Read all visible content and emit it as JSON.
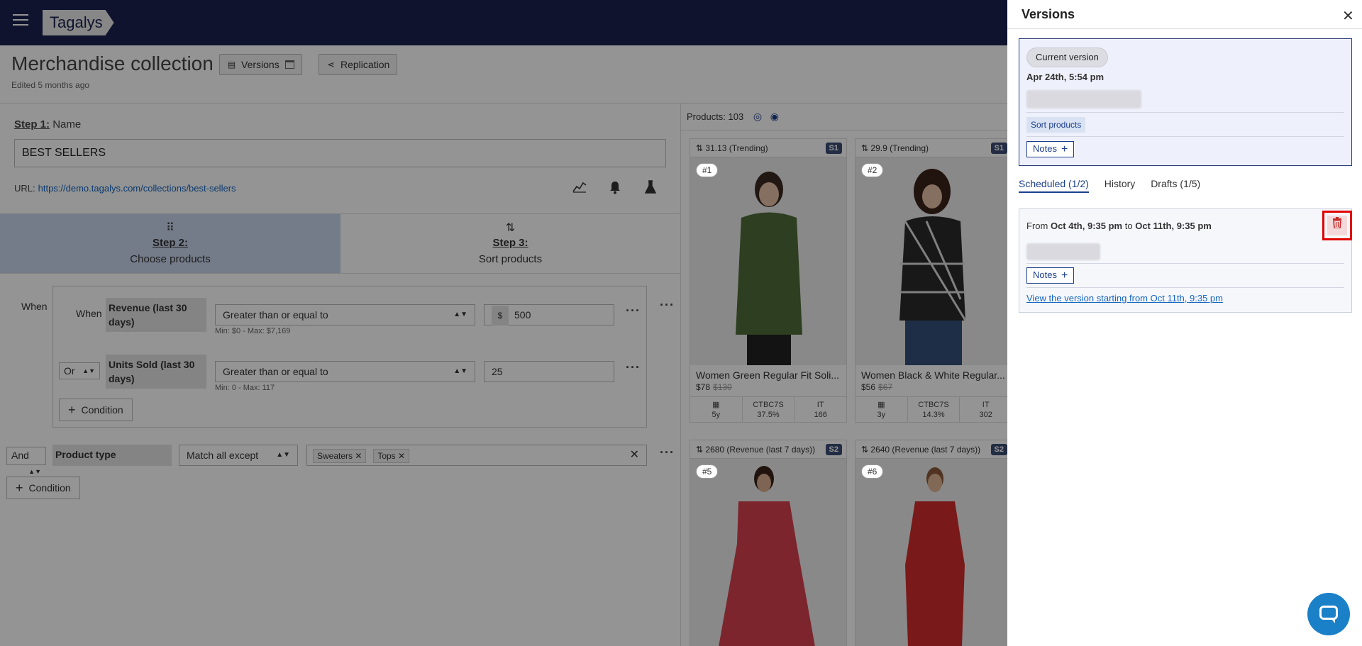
{
  "app": {
    "logo": "Tagalys"
  },
  "header": {
    "title": "Merchandise collection",
    "edited": "Edited 5 months ago",
    "versions_label": "Versions",
    "replication_label": "Replication"
  },
  "step1": {
    "step": "Step 1:",
    "label": "Name",
    "name_value": "BEST SELLERS",
    "url_label": "URL:",
    "url": "https://demo.tagalys.com/collections/best-sellers"
  },
  "steps": [
    {
      "step": "Step 2:",
      "label": "Choose products"
    },
    {
      "step": "Step 3:",
      "label": "Sort products"
    }
  ],
  "conditions": {
    "when_outer": "When",
    "when_inner": "When",
    "rows": [
      {
        "field": "Revenue (last 30 days)",
        "operator": "Greater than or equal to",
        "currency": "$",
        "value": "500",
        "hint": "Min: $0 - Max: $7,169"
      },
      {
        "join": "Or",
        "field": "Units Sold (last 30 days)",
        "operator": "Greater than or equal to",
        "value": "25",
        "hint": "Min: 0 - Max: 117"
      }
    ],
    "condition_btn": "Condition",
    "and_row": {
      "join": "And",
      "field": "Product type",
      "operator": "Match all except",
      "tags": [
        "Sweaters",
        "Tops"
      ]
    }
  },
  "products": {
    "header": "Products: 103",
    "cards": [
      {
        "sort": "31.13 (Trending)",
        "badge": "S1",
        "rank": "#1",
        "name": "Women Green Regular Fit Soli...",
        "price": "$78",
        "old_price": "$130",
        "stats": [
          {
            "top": "",
            "bot": "5y"
          },
          {
            "top": "CTBC7S",
            "bot": "37.5%"
          },
          {
            "top": "IT",
            "bot": "166"
          }
        ],
        "color": "#4f6b3a"
      },
      {
        "sort": "29.9 (Trending)",
        "badge": "S1",
        "rank": "#2",
        "name": "Women Black & White Regular...",
        "price": "$56",
        "old_price": "$67",
        "stats": [
          {
            "top": "",
            "bot": "3y"
          },
          {
            "top": "CTBC7S",
            "bot": "14.3%"
          },
          {
            "top": "IT",
            "bot": "302"
          }
        ],
        "color": "#2a2a2a"
      },
      {
        "sort": "2680 (Revenue (last 7 days))",
        "badge": "S2",
        "rank": "#5",
        "color": "#d6404f"
      },
      {
        "sort": "2640 (Revenue (last 7 days))",
        "badge": "S2",
        "rank": "#6",
        "color": "#d22b2b"
      }
    ]
  },
  "versions": {
    "title": "Versions",
    "current_pill": "Current version",
    "current_date": "Apr 24th, 5:54 pm",
    "sort_chip": "Sort products",
    "notes": "Notes",
    "tabs": [
      "Scheduled (1/2)",
      "History",
      "Drafts (1/5)"
    ],
    "sched_from": "From",
    "sched_start": "Oct 4th, 9:35 pm",
    "sched_to": "to",
    "sched_end": "Oct 11th, 9:35 pm",
    "view_link": "View the version starting from Oct 11th, 9:35 pm"
  },
  "colors": {
    "topbar": "#1b2250",
    "accent": "#1d3f8c",
    "danger": "#e10000"
  }
}
